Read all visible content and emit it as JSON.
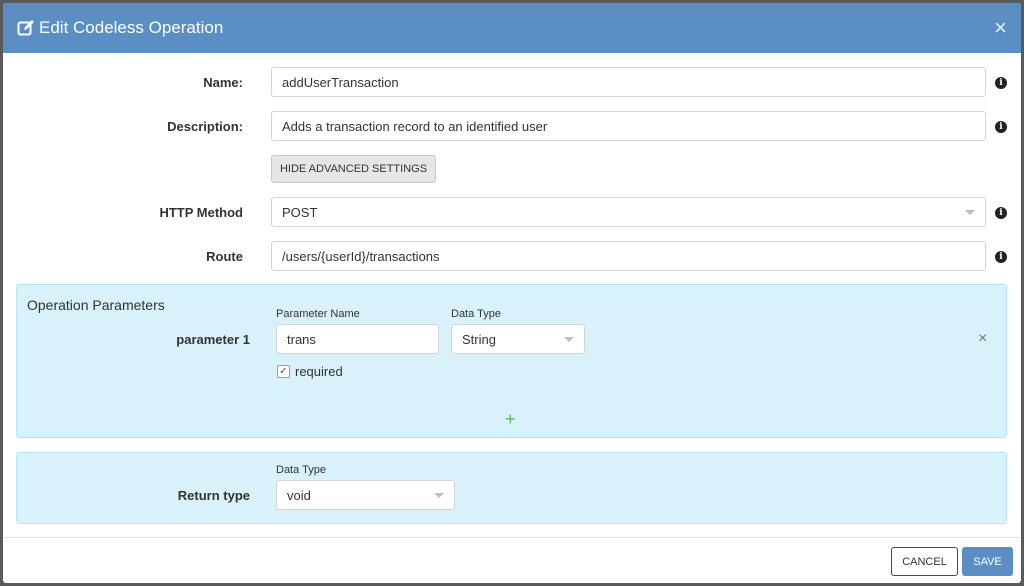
{
  "dialog": {
    "title": "Edit Codeless Operation",
    "close_icon": "×"
  },
  "form": {
    "name_label": "Name:",
    "name_value": "addUserTransaction",
    "description_label": "Description:",
    "description_value": "Adds a transaction record to an identified user",
    "advanced_button": "HIDE ADVANCED SETTINGS",
    "http_method_label": "HTTP Method",
    "http_method_value": "POST",
    "route_label": "Route",
    "route_value": "/users/{userId}/transactions",
    "info_icon": "i"
  },
  "operation_parameters": {
    "title": "Operation Parameters",
    "param_name_header": "Parameter Name",
    "data_type_header": "Data Type",
    "parameters": [
      {
        "label": "parameter 1",
        "name": "trans",
        "data_type": "String",
        "required": true,
        "required_label": "required"
      }
    ],
    "remove_icon": "×",
    "add_icon": "+"
  },
  "return_type": {
    "label": "Return type",
    "data_type_header": "Data Type",
    "value": "void"
  },
  "footer": {
    "cancel_label": "CANCEL",
    "save_label": "SAVE"
  },
  "colors": {
    "header_bg": "#5b8fc4",
    "panel_bg": "#d8f1fa",
    "add_green": "#5cb85c",
    "save_bg": "#5b8fc4"
  }
}
